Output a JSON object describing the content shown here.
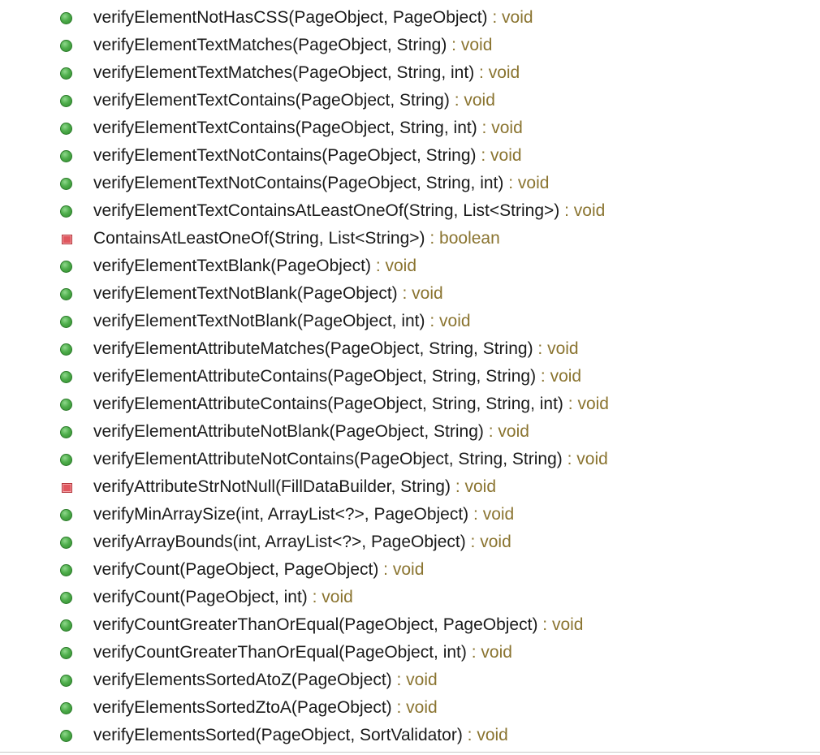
{
  "methods": [
    {
      "icon": "public-method-icon",
      "visibility": "public",
      "signature": "verifyElementNotHasCSS(PageObject, PageObject)",
      "return_type": " : void"
    },
    {
      "icon": "public-method-icon",
      "visibility": "public",
      "signature": "verifyElementTextMatches(PageObject, String)",
      "return_type": " : void"
    },
    {
      "icon": "public-method-icon",
      "visibility": "public",
      "signature": "verifyElementTextMatches(PageObject, String, int)",
      "return_type": " : void"
    },
    {
      "icon": "public-method-icon",
      "visibility": "public",
      "signature": "verifyElementTextContains(PageObject, String)",
      "return_type": " : void"
    },
    {
      "icon": "public-method-icon",
      "visibility": "public",
      "signature": "verifyElementTextContains(PageObject, String, int)",
      "return_type": " : void"
    },
    {
      "icon": "public-method-icon",
      "visibility": "public",
      "signature": "verifyElementTextNotContains(PageObject, String)",
      "return_type": " : void"
    },
    {
      "icon": "public-method-icon",
      "visibility": "public",
      "signature": "verifyElementTextNotContains(PageObject, String, int)",
      "return_type": " : void"
    },
    {
      "icon": "public-method-icon",
      "visibility": "public",
      "signature": "verifyElementTextContainsAtLeastOneOf(String, List<String>)",
      "return_type": " : void"
    },
    {
      "icon": "private-method-icon",
      "visibility": "private",
      "signature": "ContainsAtLeastOneOf(String, List<String>)",
      "return_type": " : boolean"
    },
    {
      "icon": "public-method-icon",
      "visibility": "public",
      "signature": "verifyElementTextBlank(PageObject)",
      "return_type": " : void"
    },
    {
      "icon": "public-method-icon",
      "visibility": "public",
      "signature": "verifyElementTextNotBlank(PageObject)",
      "return_type": " : void"
    },
    {
      "icon": "public-method-icon",
      "visibility": "public",
      "signature": "verifyElementTextNotBlank(PageObject, int)",
      "return_type": " : void"
    },
    {
      "icon": "public-method-icon",
      "visibility": "public",
      "signature": "verifyElementAttributeMatches(PageObject, String, String)",
      "return_type": " : void"
    },
    {
      "icon": "public-method-icon",
      "visibility": "public",
      "signature": "verifyElementAttributeContains(PageObject, String, String)",
      "return_type": " : void"
    },
    {
      "icon": "public-method-icon",
      "visibility": "public",
      "signature": "verifyElementAttributeContains(PageObject, String, String, int)",
      "return_type": " : void"
    },
    {
      "icon": "public-method-icon",
      "visibility": "public",
      "signature": "verifyElementAttributeNotBlank(PageObject, String)",
      "return_type": " : void"
    },
    {
      "icon": "public-method-icon",
      "visibility": "public",
      "signature": "verifyElementAttributeNotContains(PageObject, String, String)",
      "return_type": " : void"
    },
    {
      "icon": "private-method-icon",
      "visibility": "private",
      "signature": "verifyAttributeStrNotNull(FillDataBuilder, String)",
      "return_type": " : void"
    },
    {
      "icon": "public-method-icon",
      "visibility": "public",
      "signature": "verifyMinArraySize(int, ArrayList<?>, PageObject)",
      "return_type": " : void"
    },
    {
      "icon": "public-method-icon",
      "visibility": "public",
      "signature": "verifyArrayBounds(int, ArrayList<?>, PageObject)",
      "return_type": " : void"
    },
    {
      "icon": "public-method-icon",
      "visibility": "public",
      "signature": "verifyCount(PageObject, PageObject)",
      "return_type": " : void"
    },
    {
      "icon": "public-method-icon",
      "visibility": "public",
      "signature": "verifyCount(PageObject, int)",
      "return_type": " : void"
    },
    {
      "icon": "public-method-icon",
      "visibility": "public",
      "signature": "verifyCountGreaterThanOrEqual(PageObject, PageObject)",
      "return_type": " : void"
    },
    {
      "icon": "public-method-icon",
      "visibility": "public",
      "signature": "verifyCountGreaterThanOrEqual(PageObject, int)",
      "return_type": " : void"
    },
    {
      "icon": "public-method-icon",
      "visibility": "public",
      "signature": "verifyElementsSortedAtoZ(PageObject)",
      "return_type": " : void"
    },
    {
      "icon": "public-method-icon",
      "visibility": "public",
      "signature": "verifyElementsSortedZtoA(PageObject)",
      "return_type": " : void"
    },
    {
      "icon": "public-method-icon",
      "visibility": "public",
      "signature": "verifyElementsSorted(PageObject, SortValidator)",
      "return_type": " : void"
    }
  ],
  "colors": {
    "public_icon": "#4fae4c",
    "private_icon": "#e0575f",
    "signature_text": "#1a1a1a",
    "return_type_text": "#8a7430"
  }
}
